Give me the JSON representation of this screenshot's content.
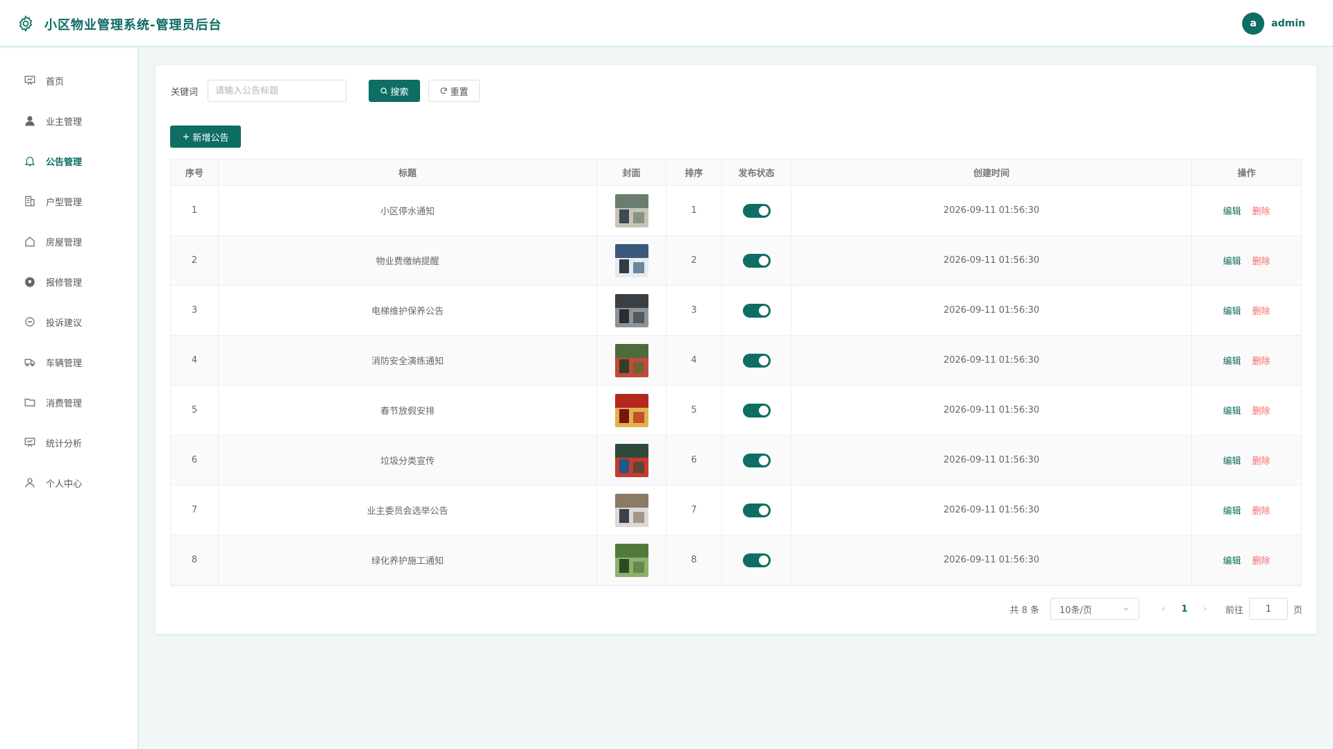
{
  "header": {
    "title": "小区物业管理系统-管理员后台",
    "avatar_letter": "a",
    "username": "admin"
  },
  "sidebar": {
    "items": [
      {
        "label": "首页",
        "icon": "presentation-icon"
      },
      {
        "label": "业主管理",
        "icon": "user-icon"
      },
      {
        "label": "公告管理",
        "icon": "bell-icon",
        "active": true
      },
      {
        "label": "户型管理",
        "icon": "building-icon"
      },
      {
        "label": "房屋管理",
        "icon": "house-icon"
      },
      {
        "label": "报修管理",
        "icon": "gear-icon"
      },
      {
        "label": "投诉建议",
        "icon": "chat-icon"
      },
      {
        "label": "车辆管理",
        "icon": "truck-icon"
      },
      {
        "label": "消费管理",
        "icon": "folder-icon"
      },
      {
        "label": "统计分析",
        "icon": "chart-board-icon"
      },
      {
        "label": "个人中心",
        "icon": "person-icon"
      }
    ]
  },
  "search": {
    "label": "关键词",
    "placeholder": "请输入公告标题",
    "value": "",
    "search_label": "搜索",
    "reset_label": "重置"
  },
  "toolbar": {
    "add_label": "新增公告"
  },
  "table": {
    "headers": [
      "序号",
      "标题",
      "封面",
      "排序",
      "发布状态",
      "创建时间",
      "操作"
    ],
    "edit_label": "编辑",
    "delete_label": "删除",
    "rows": [
      {
        "no": "1",
        "title": "小区停水通知",
        "sort": "1",
        "published": true,
        "created": "2026-09-11 01:56:30"
      },
      {
        "no": "2",
        "title": "物业费缴纳提醒",
        "sort": "2",
        "published": true,
        "created": "2026-09-11 01:56:30"
      },
      {
        "no": "3",
        "title": "电梯维护保养公告",
        "sort": "3",
        "published": true,
        "created": "2026-09-11 01:56:30"
      },
      {
        "no": "4",
        "title": "消防安全演练通知",
        "sort": "4",
        "published": true,
        "created": "2026-09-11 01:56:30"
      },
      {
        "no": "5",
        "title": "春节放假安排",
        "sort": "5",
        "published": true,
        "created": "2026-09-11 01:56:30"
      },
      {
        "no": "6",
        "title": "垃圾分类宣传",
        "sort": "6",
        "published": true,
        "created": "2026-09-11 01:56:30"
      },
      {
        "no": "7",
        "title": "业主委员会选举公告",
        "sort": "7",
        "published": true,
        "created": "2026-09-11 01:56:30"
      },
      {
        "no": "8",
        "title": "绿化养护施工通知",
        "sort": "8",
        "published": true,
        "created": "2026-09-11 01:56:30"
      }
    ]
  },
  "pagination": {
    "total": "共 8 条",
    "page_size": "10条/页",
    "current_page": "1",
    "goto_label": "前往",
    "goto_value": "1",
    "page_suffix": "页"
  },
  "colors": {
    "primary": "#0e6e63",
    "danger": "#f56c6c",
    "background": "#f0f7f6"
  }
}
